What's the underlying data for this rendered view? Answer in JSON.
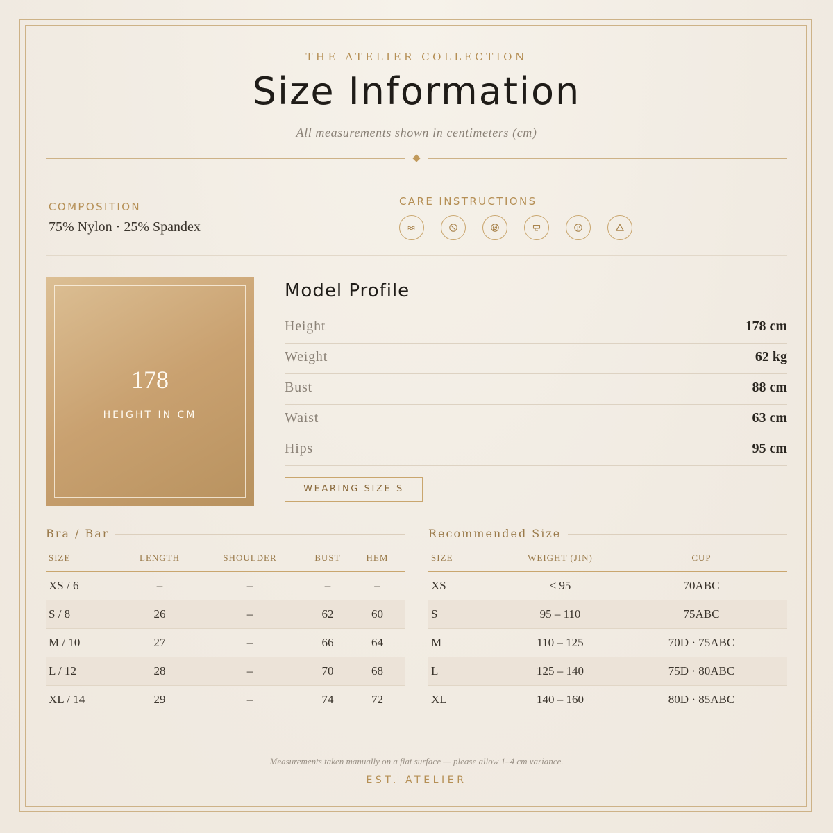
{
  "header": {
    "eyebrow": "THE ATELIER COLLECTION",
    "title": "Size Information",
    "subtitle": "All measurements shown in centimeters (cm)"
  },
  "composition": {
    "label": "COMPOSITION",
    "value": "75% Nylon  ·  25% Spandex"
  },
  "care": {
    "label": "CARE INSTRUCTIONS",
    "icons": [
      "hand-wash-icon",
      "do-not-bleach-icon",
      "do-not-tumble-dry-icon",
      "iron-low-icon",
      "dry-clean-icon",
      "bleach-triangle-icon"
    ]
  },
  "hero": {
    "number": "178",
    "caption": "HEIGHT IN CM"
  },
  "model": {
    "title": "Model Profile",
    "rows": [
      {
        "label": "Height",
        "value": "178 cm"
      },
      {
        "label": "Weight",
        "value": "62 kg"
      },
      {
        "label": "Bust",
        "value": "88 cm"
      },
      {
        "label": "Waist",
        "value": "63 cm"
      },
      {
        "label": "Hips",
        "value": "95 cm"
      }
    ],
    "wearing": "WEARING SIZE  S"
  },
  "bra_table": {
    "title": "Bra / Bar",
    "headers": [
      "SIZE",
      "LENGTH",
      "SHOULDER",
      "BUST",
      "HEM"
    ],
    "rows": [
      [
        "XS / 6",
        "–",
        "–",
        "–",
        "–"
      ],
      [
        "S / 8",
        "26",
        "–",
        "62",
        "60"
      ],
      [
        "M / 10",
        "27",
        "–",
        "66",
        "64"
      ],
      [
        "L / 12",
        "28",
        "–",
        "70",
        "68"
      ],
      [
        "XL / 14",
        "29",
        "–",
        "74",
        "72"
      ]
    ]
  },
  "rec_table": {
    "title": "Recommended Size",
    "headers": [
      "SIZE",
      "WEIGHT (JIN)",
      "CUP"
    ],
    "rows": [
      [
        "XS",
        "< 95",
        "70ABC"
      ],
      [
        "S",
        "95 – 110",
        "75ABC"
      ],
      [
        "M",
        "110 – 125",
        "70D · 75ABC"
      ],
      [
        "L",
        "125 – 140",
        "75D · 80ABC"
      ],
      [
        "XL",
        "140 – 160",
        "80D · 85ABC"
      ]
    ]
  },
  "footer": {
    "note": "Measurements taken manually on a flat surface — please allow 1–4 cm variance.",
    "mark": "EST.  ATELIER"
  },
  "colors": {
    "accent": "#b58f55",
    "background": "#f1ebe2",
    "hero_gradient_start": "#dcbf94",
    "hero_gradient_end": "#b8925f"
  }
}
